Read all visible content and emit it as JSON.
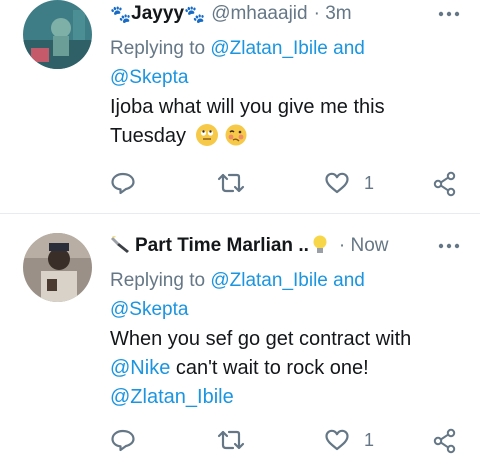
{
  "tweets": [
    {
      "name": "Jayyy",
      "handle": "@mhaaajid",
      "time": "· 3m",
      "replying_prefix": "Replying to ",
      "replying_to": "@Zlatan_Ibile and",
      "replying_to_2": "@Skepta",
      "text_line1": "Ijoba what will you give me this",
      "text_line2": "Tuesday",
      "reply_count": "",
      "like_count": "1"
    },
    {
      "name": "Part Time Marlian ..",
      "handle": "",
      "time": "· Now",
      "replying_prefix": "Replying to ",
      "replying_to": "@Zlatan_Ibile and",
      "replying_to_2": "@Skepta",
      "text_line1": "When you sef go get contract with",
      "text_line2_link": "@Nike",
      "text_line2_rest": " can't wait to rock one!",
      "text_line3_link": "@Zlatan_Ibile",
      "like_count": "1"
    }
  ],
  "icons": [
    "paw-icon",
    "more-icon",
    "reply-icon",
    "retweet-icon",
    "like-icon",
    "share-icon",
    "flashlight-icon",
    "bulb-icon",
    "eye-roll-emoji",
    "woozy-emoji"
  ],
  "colors": {
    "link": "#1b95e0",
    "muted": "#657786",
    "text": "#14171a",
    "divider": "#e6ecf0"
  }
}
